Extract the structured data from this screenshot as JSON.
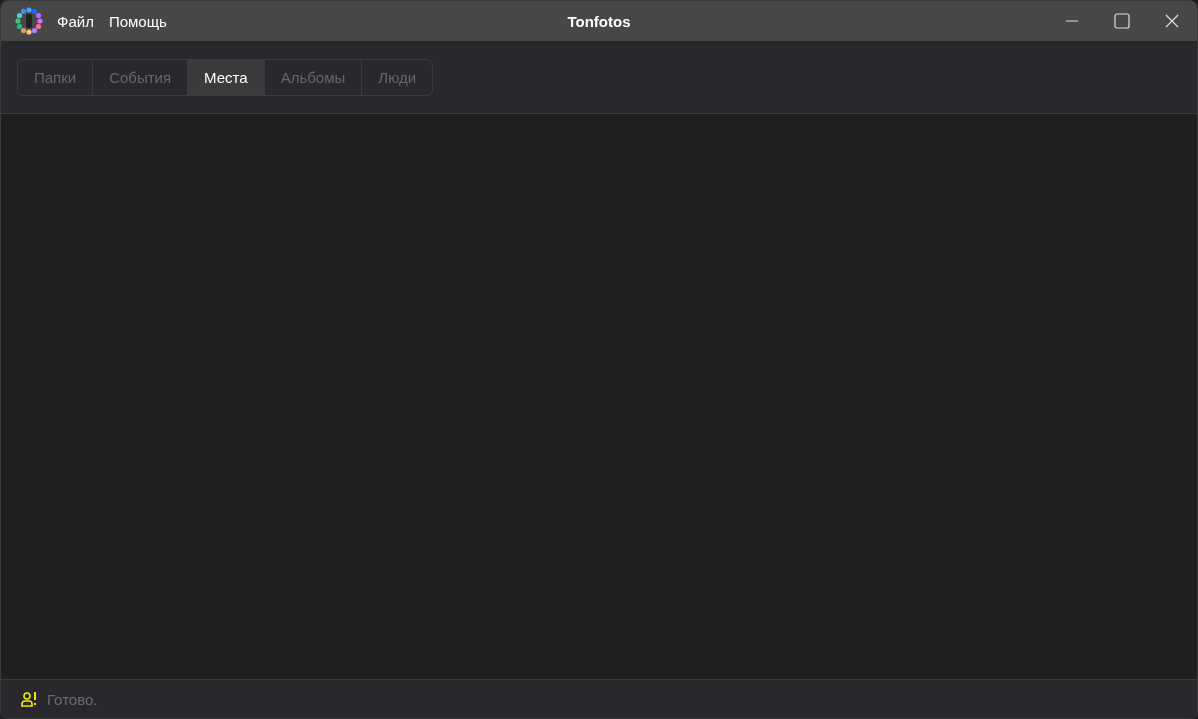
{
  "window": {
    "title": "Tonfotos"
  },
  "menu": [
    "Файл",
    "Помощь"
  ],
  "tabs": [
    {
      "label": "Папки",
      "selected": false
    },
    {
      "label": "События",
      "selected": false
    },
    {
      "label": "Места",
      "selected": true
    },
    {
      "label": "Альбомы",
      "selected": false
    },
    {
      "label": "Люди",
      "selected": false
    }
  ],
  "status_bar": {
    "text": "Готово."
  }
}
